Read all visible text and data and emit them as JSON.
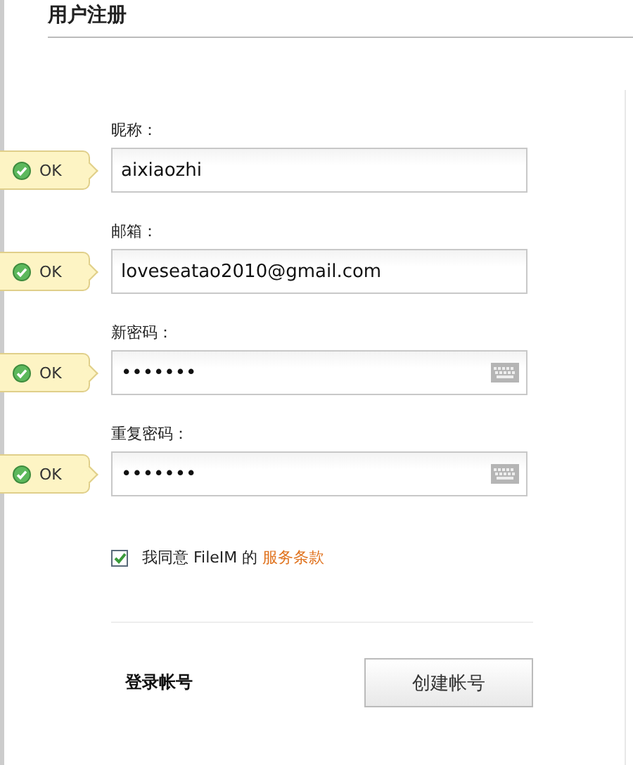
{
  "page": {
    "title": "用户注册"
  },
  "fields": [
    {
      "label": "昵称：",
      "kind": "text",
      "value": "aixiaozhi",
      "badge": "OK",
      "valid": true
    },
    {
      "label": "邮箱：",
      "kind": "text",
      "value": "loveseatao2010@gmail.com",
      "badge": "OK",
      "valid": true
    },
    {
      "label": "新密码：",
      "kind": "password",
      "value": "•••••••",
      "badge": "OK",
      "valid": true
    },
    {
      "label": "重复密码：",
      "kind": "password",
      "value": "•••••••",
      "badge": "OK",
      "valid": true
    }
  ],
  "agreement": {
    "checked": true,
    "text": "我同意 FileIM 的",
    "link": "服务条款"
  },
  "login_link": "登录帐号",
  "create_button": "创建帐号"
}
